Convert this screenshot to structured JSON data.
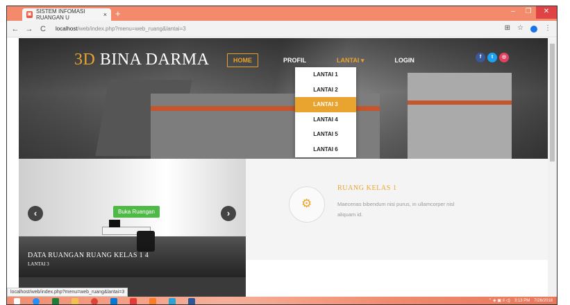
{
  "browser": {
    "tab_title": "SISTEM INFOMASI RUANGAN U",
    "tab_close": "×",
    "new_tab": "+",
    "url_host": "localhost",
    "url_rest": "/web/index.php?menu=web_ruang&lantai=3",
    "status_url": "localhost/web/index.php?menu=web_ruang&lantai=3"
  },
  "site": {
    "logo_accent": "3D",
    "logo_text": " BINA DARMA",
    "menu": {
      "home": "HOME",
      "profil": "PROFIL",
      "lantai": "LANTAI ▾",
      "login": "LOGIN"
    },
    "dropdown": [
      "LANTAI 1",
      "LANTAI 2",
      "LANTAI 3",
      "LANTAI 4",
      "LANTAI 5",
      "LANTAI 6"
    ],
    "dropdown_active_index": 2,
    "social": {
      "facebook": "f",
      "twitter": "t",
      "instagram": "◎"
    }
  },
  "slider": {
    "button_label": "Buka Ruangan",
    "caption_title": "Data Ruangan Ruang Kelas 1 4",
    "caption_sub": "Lantai 3",
    "prev": "‹",
    "next": "›"
  },
  "room": {
    "title": "RUANG KELAS 1",
    "description": "Maecenas bibendum nisi purus, in ullamcorper nisl aliquam id."
  },
  "taskbar": {
    "time": "3:13 PM",
    "date": "7/26/2018"
  },
  "colors": {
    "accent": "#e8a42f",
    "button_green": "#4fb947",
    "chrome_orange": "#f28a6b"
  }
}
